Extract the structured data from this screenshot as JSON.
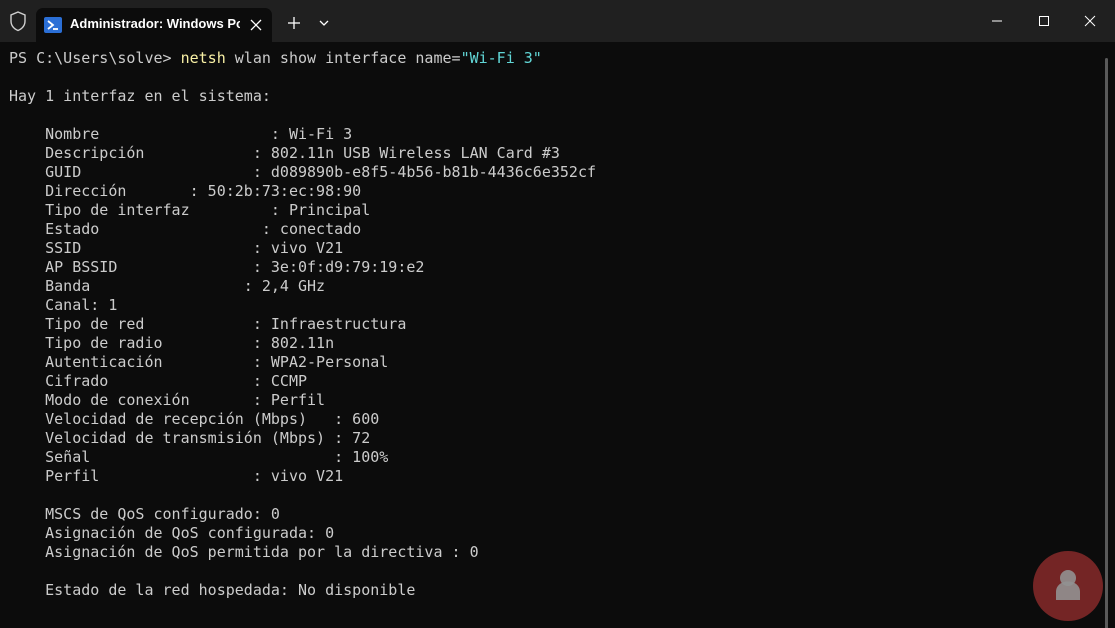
{
  "titlebar": {
    "tab_title": "Administrador: Windows Pow"
  },
  "prompt": {
    "prefix": "PS C:\\Users\\solve> ",
    "command": "netsh",
    "args": " wlan show interface name=",
    "string": "\"Wi-Fi 3\""
  },
  "lines": {
    "intro": "Hay 1 interfaz en el sistema:",
    "nombre": "    Nombre                   : Wi-Fi 3",
    "descripcion": "    Descripción            : 802.11n USB Wireless LAN Card #3",
    "guid": "    GUID                   : d089890b-e8f5-4b56-b81b-4436c6e352cf",
    "direccion": "    Dirección       : 50:2b:73:ec:98:90",
    "tipo_interfaz": "    Tipo de interfaz         : Principal",
    "estado": "    Estado                  : conectado",
    "ssid": "    SSID                   : vivo V21",
    "ap_bssid": "    AP BSSID               : 3e:0f:d9:79:19:e2",
    "banda": "    Banda                 : 2,4 GHz",
    "canal": "    Canal: 1",
    "tipo_red": "    Tipo de red            : Infraestructura",
    "tipo_radio": "    Tipo de radio          : 802.11n",
    "autenticacion": "    Autenticación          : WPA2-Personal",
    "cifrado": "    Cifrado                : CCMP",
    "modo_conexion": "    Modo de conexión       : Perfil",
    "vel_recepcion": "    Velocidad de recepción (Mbps)   : 600",
    "vel_transmision": "    Velocidad de transmisión (Mbps) : 72",
    "senal": "    Señal                           : 100%",
    "perfil": "    Perfil                 : vivo V21",
    "mscs": "    MSCS de QoS configurado: 0",
    "qos_configurada": "    Asignación de QoS configurada: 0",
    "qos_permitida": "    Asignación de QoS permitida por la directiva : 0",
    "red_hospedada": "    Estado de la red hospedada: No disponible"
  },
  "colors": {
    "background": "#0c0c0c",
    "titlebar": "#202020",
    "text": "#cccccc",
    "command": "#f9f1a5",
    "string": "#61d6d6"
  }
}
